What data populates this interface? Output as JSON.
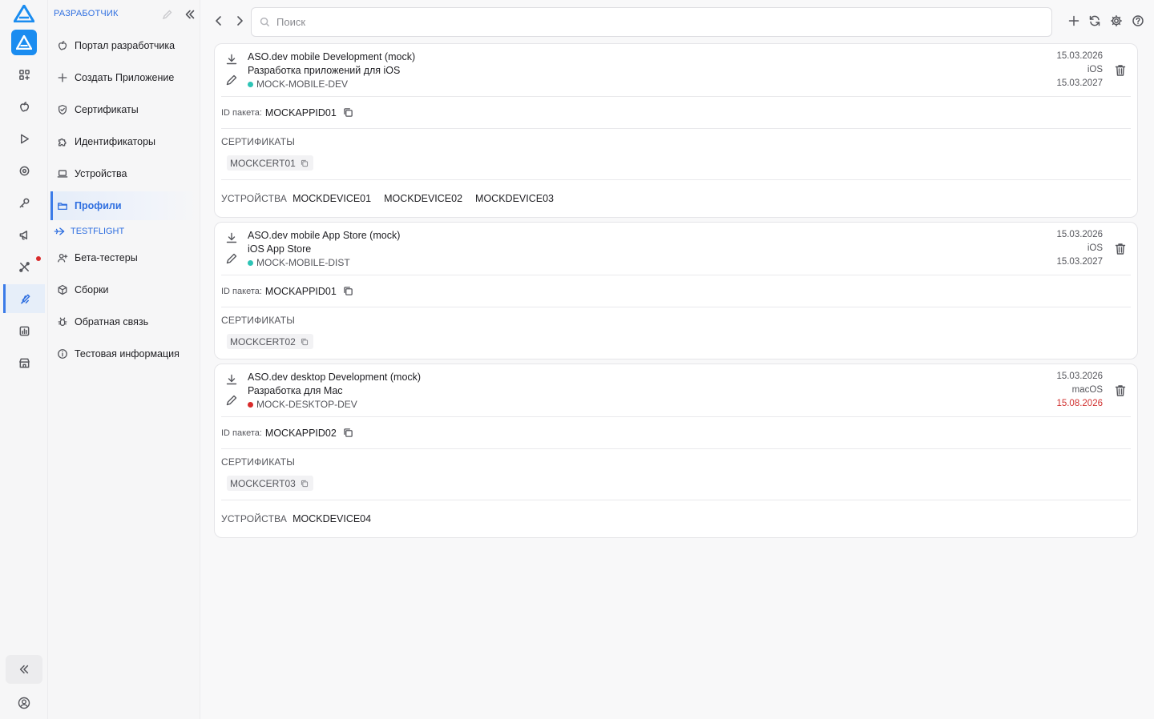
{
  "colors": {
    "accent": "#2f6fe0",
    "brand": "#1a8cf0",
    "status_ok": "#2ec4b6",
    "status_warn": "#d0302f"
  },
  "rail": {
    "icons": [
      "apps-grid-icon",
      "apple-icon",
      "play-icon",
      "target-icon",
      "key-icon",
      "megaphone-icon",
      "tools-icon",
      "xcode-icon",
      "chart-icon",
      "store-icon"
    ],
    "active": "xcode-icon"
  },
  "sidebar": {
    "header": "РАЗРАБОТЧИК",
    "items": [
      {
        "label": "Портал разработчика",
        "icon": "apple-icon"
      },
      {
        "label": "Создать Приложение",
        "icon": "plus-icon"
      },
      {
        "label": "Сертификаты",
        "icon": "shield-check-icon"
      },
      {
        "label": "Идентификаторы",
        "icon": "puzzle-icon"
      },
      {
        "label": "Устройства",
        "icon": "laptop-icon"
      },
      {
        "label": "Профили",
        "icon": "folder-icon",
        "active": true
      }
    ],
    "section": "TESTFLIGHT",
    "testflight_items": [
      {
        "label": "Бета-тестеры",
        "icon": "user-plus-icon"
      },
      {
        "label": "Сборки",
        "icon": "box-icon"
      },
      {
        "label": "Обратная связь",
        "icon": "bug-icon"
      },
      {
        "label": "Тестовая информация",
        "icon": "info-icon"
      }
    ]
  },
  "search": {
    "placeholder": "Поиск",
    "value": ""
  },
  "labels": {
    "bundle_id": "ID пакета:",
    "certificates": "СЕРТИФИКАТЫ",
    "devices": "УСТРОЙСТВА"
  },
  "profiles": [
    {
      "title": "ASO.dev mobile Development (mock)",
      "subtitle": "Разработка приложений для iOS",
      "identifier": "MOCK-MOBILE-DEV",
      "status_color": "#2ec4b6",
      "created": "15.03.2026",
      "platform": "iOS",
      "expires": "15.03.2027",
      "bundle_id": "MOCKAPPID01",
      "certificates": [
        "MOCKCERT01"
      ],
      "devices": [
        "MOCKDEVICE01",
        "MOCKDEVICE02",
        "MOCKDEVICE03"
      ]
    },
    {
      "title": "ASO.dev mobile App Store (mock)",
      "subtitle": "iOS App Store",
      "identifier": "MOCK-MOBILE-DIST",
      "status_color": "#2ec4b6",
      "created": "15.03.2026",
      "platform": "iOS",
      "expires": "15.03.2027",
      "bundle_id": "MOCKAPPID01",
      "certificates": [
        "MOCKCERT02"
      ],
      "devices": []
    },
    {
      "title": "ASO.dev desktop Development (mock)",
      "subtitle": "Разработка для Mac",
      "identifier": "MOCK-DESKTOP-DEV",
      "status_color": "#d92b2b",
      "created": "15.03.2026",
      "platform": "macOS",
      "expires": "15.08.2026",
      "expires_soon": true,
      "bundle_id": "MOCKAPPID02",
      "certificates": [
        "MOCKCERT03"
      ],
      "devices": [
        "MOCKDEVICE04"
      ]
    }
  ]
}
